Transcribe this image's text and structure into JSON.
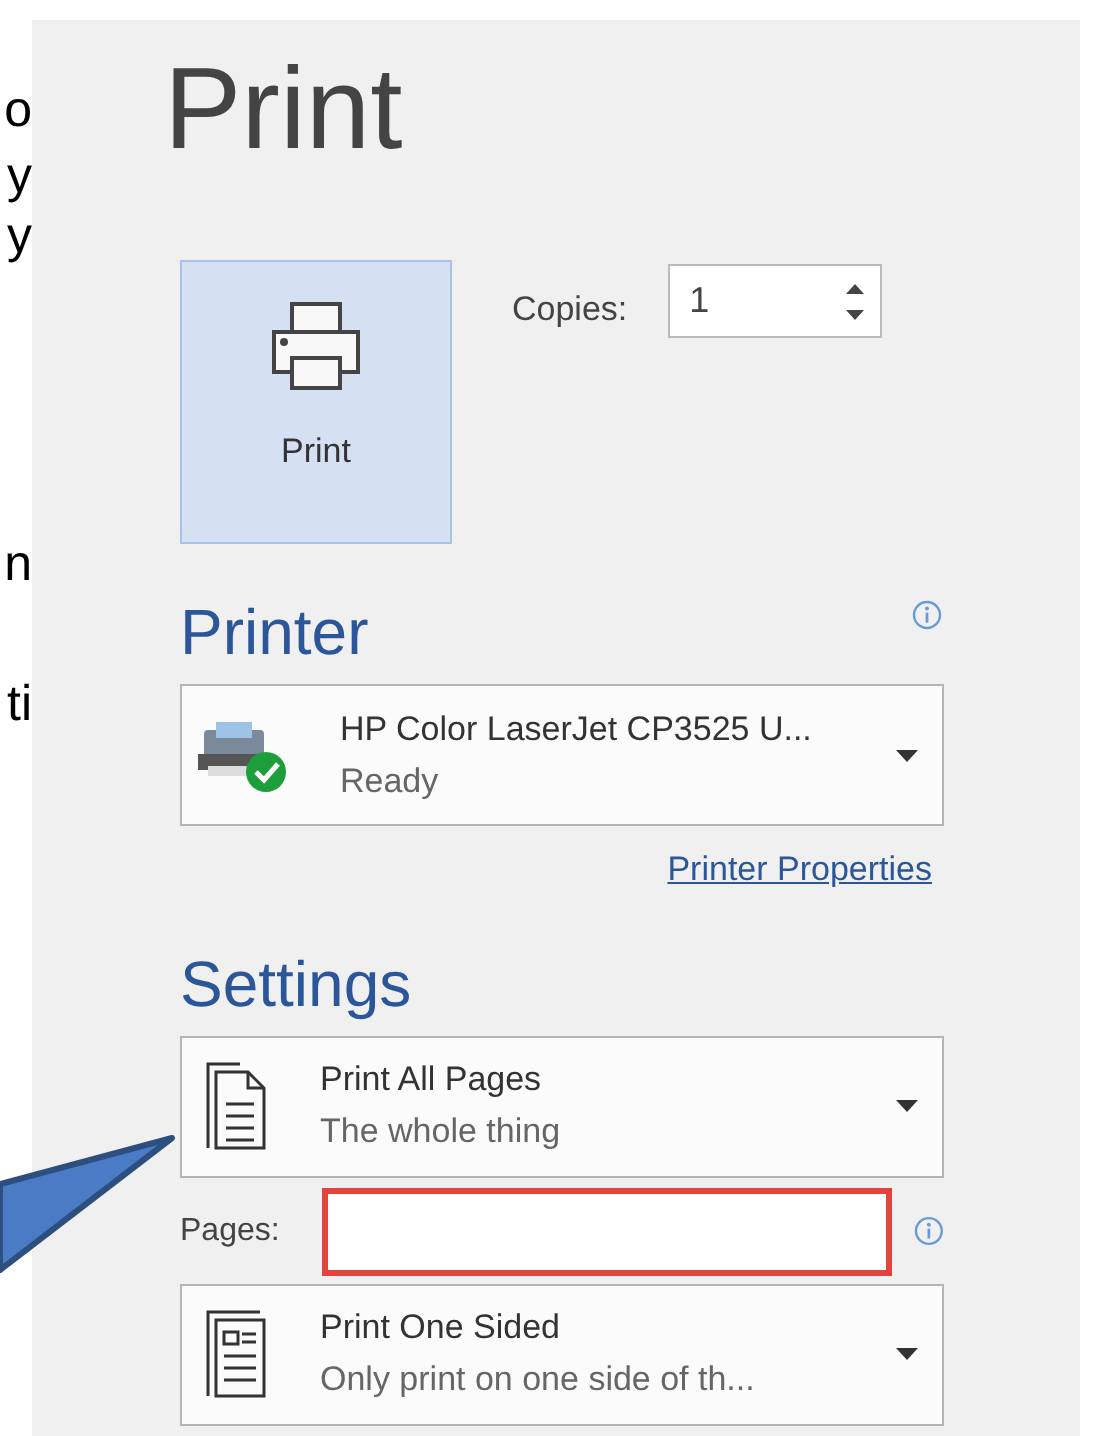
{
  "left_fragments": [
    "o",
    "y",
    "y",
    "n",
    "ti"
  ],
  "title": "Print",
  "print_button": {
    "label": "Print"
  },
  "copies": {
    "label": "Copies:",
    "value": "1"
  },
  "printer": {
    "heading": "Printer",
    "name": "HP Color LaserJet CP3525 U...",
    "status": "Ready",
    "properties_link": "Printer Properties"
  },
  "settings": {
    "heading": "Settings",
    "dropdowns": [
      {
        "kind": "pages",
        "title": "Print All Pages",
        "subtitle": "The whole thing"
      },
      {
        "kind": "sides",
        "title": "Print One Sided",
        "subtitle": "Only print on one side of th..."
      }
    ],
    "pages": {
      "label": "Pages:",
      "highlighted": true
    }
  }
}
